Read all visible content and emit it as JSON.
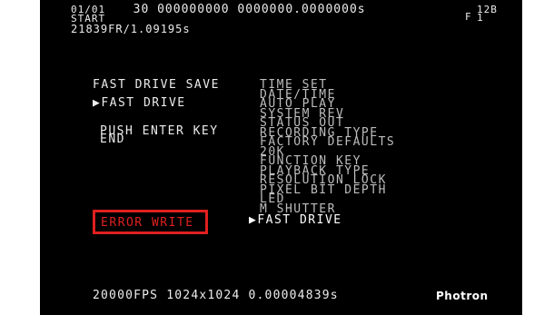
{
  "status": {
    "frame_count": "01/01",
    "time_readout": "30 000000000 0000000.0000000s",
    "start_label": "START",
    "frame_time": "21839FR/1.09195s",
    "mode_letter": "F",
    "bit_top": "12B",
    "bit_bottom": "1"
  },
  "left_panel": {
    "title": "FAST DRIVE SAVE",
    "selected": "▶FAST DRIVE",
    "prompt": "PUSH ENTER KEY",
    "end_label": "END",
    "error": "ERROR WRITE",
    "error_color": "#e02020"
  },
  "menu": {
    "items": [
      "TIME SET",
      "DATE/TIME",
      "AUTO PLAY",
      "SYSTEM REV",
      "STATUS OUT",
      "RECORDING TYPE",
      "FACTORY DEFAULTS",
      "20K",
      "FUNCTION KEY",
      "PLAYBACK TYPE",
      "RESOLUTION LOCK",
      "PIXEL BIT DEPTH",
      "LED",
      "M SHUTTER",
      "▶FAST DRIVE"
    ],
    "selected_index": 14
  },
  "footer": {
    "recording_info": "20000FPS 1024x1024 0.00004839s",
    "brand": "Photron"
  }
}
